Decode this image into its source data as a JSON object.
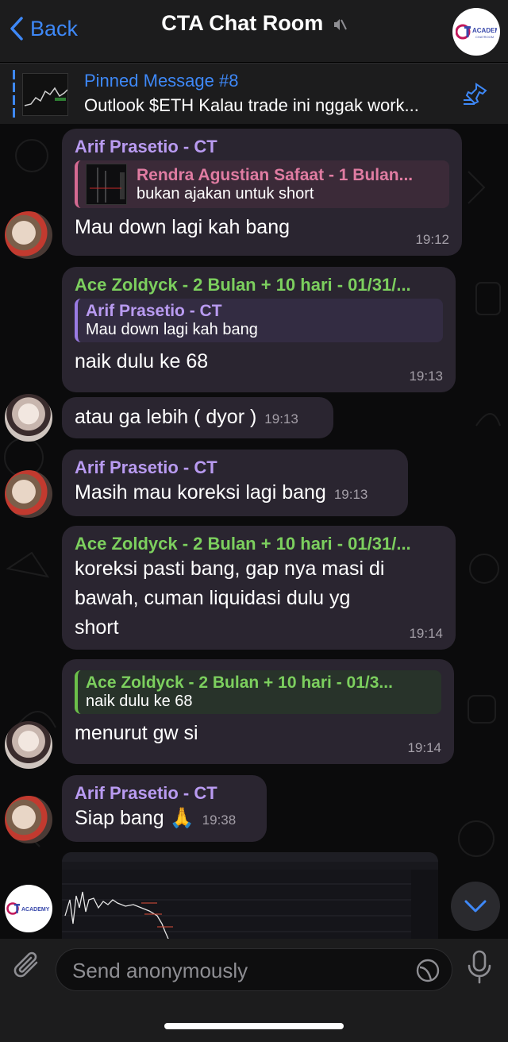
{
  "header": {
    "back_label": "Back",
    "title": "CTA Chat Room",
    "logo_text": "ACADEMY",
    "logo_sub": "CHATROOM"
  },
  "pinned": {
    "title": "Pinned Message #8",
    "text": "Outlook $ETH Kalau trade ini nggak work..."
  },
  "messages": [
    {
      "sender": "Arif Prasetio - CT",
      "reply_name": "Rendra Agustian Safaat - 1 Bulan...",
      "reply_text": "bukan ajakan untuk short",
      "text": "Mau down lagi kah bang",
      "time": "19:12"
    },
    {
      "sender": "Ace Zoldyck - 2 Bulan + 10 hari - 01/31/...",
      "reply_name": "Arif Prasetio - CT",
      "reply_text": "Mau down lagi kah bang",
      "text": "naik dulu ke 68",
      "time": "19:13"
    },
    {
      "text": "atau ga lebih ( dyor )",
      "time": "19:13"
    },
    {
      "sender": "Arif Prasetio - CT",
      "text": "Masih mau koreksi lagi bang",
      "time": "19:13"
    },
    {
      "sender": "Ace Zoldyck - 2 Bulan + 10 hari - 01/31/...",
      "line1": "koreksi pasti bang, gap nya masi di",
      "line2": "bawah, cuman liquidasi dulu yg",
      "line3": "short",
      "time": "19:14"
    },
    {
      "reply_name": "Ace Zoldyck - 2 Bulan + 10 hari - 01/3...",
      "reply_text": "naik dulu ke 68",
      "text": "menurut gw si",
      "time": "19:14"
    },
    {
      "sender": "Arif Prasetio - CT",
      "text": "Siap bang 🙏",
      "time": "19:38"
    }
  ],
  "input": {
    "placeholder": "Send anonymously"
  },
  "colors": {
    "accent": "#3e88f7",
    "purple_name": "#b99bf1",
    "green_name": "#7ccf5e",
    "bubble": "#2a2530"
  }
}
